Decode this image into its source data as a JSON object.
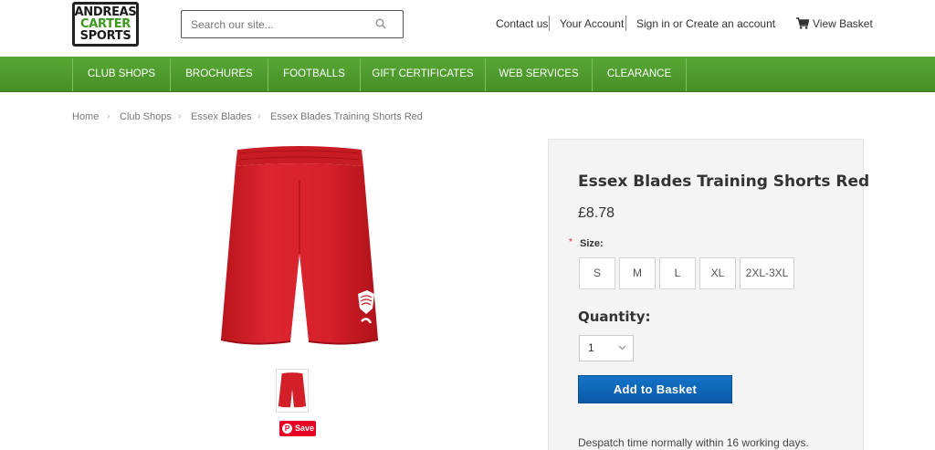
{
  "header": {
    "logo": {
      "line1": "ANDREAS",
      "line2": "CARTER",
      "line3": "SPORTS"
    },
    "search": {
      "placeholder": "Search our site...",
      "icon": "search-icon"
    },
    "links": {
      "contact": "Contact us",
      "account": "Your Account",
      "sign_in": "Sign in or Create an account",
      "basket": "View Basket"
    }
  },
  "nav": {
    "items": [
      "CLUB SHOPS",
      "BROCHURES",
      "FOOTBALLS",
      "GIFT CERTIFICATES",
      "WEB SERVICES",
      "CLEARANCE"
    ]
  },
  "breadcrumb": [
    "Home",
    "Club Shops",
    "Essex Blades",
    "Essex Blades Training Shorts Red"
  ],
  "breadcrumb_separator": "›",
  "product": {
    "title": "Essex Blades Training Shorts Red",
    "price": "£8.78",
    "required_marker": "*",
    "size_label": "Size:",
    "sizes": [
      "S",
      "M",
      "L",
      "XL",
      "2XL-3XL"
    ],
    "quantity_label": "Quantity:",
    "quantity_value": "1",
    "add_button": "Add to Basket",
    "despatch": "Despatch time normally within 16 working days.",
    "pin_label": "Save",
    "pin_icon_glyph": "P"
  },
  "colors": {
    "nav_green": "#4f9d2d",
    "button_blue": "#0b5aa8",
    "product_red": "#d8202a"
  }
}
